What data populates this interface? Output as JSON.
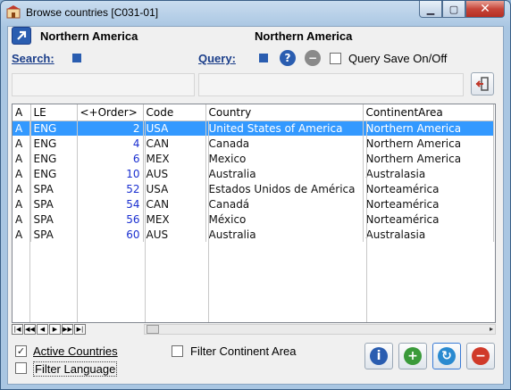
{
  "window": {
    "title": "Browse countries [C031-01]"
  },
  "header": {
    "left_title": "Northern America",
    "center_title": "Northern America",
    "search_label": "Search:",
    "query_label": "Query:",
    "query_save_label": "Query Save On/Off"
  },
  "grid": {
    "columns": [
      "A",
      "LE",
      "<+Order>",
      "Code",
      "Country",
      "ContinentArea"
    ],
    "rows": [
      {
        "a": "A",
        "le": "ENG",
        "order": "2",
        "code": "USA",
        "country": "United States of America",
        "continent": "Northern America",
        "selected": true
      },
      {
        "a": "A",
        "le": "ENG",
        "order": "4",
        "code": "CAN",
        "country": "Canada",
        "continent": "Northern America",
        "selected": false
      },
      {
        "a": "A",
        "le": "ENG",
        "order": "6",
        "code": "MEX",
        "country": "Mexico",
        "continent": "Northern America",
        "selected": false
      },
      {
        "a": "A",
        "le": "ENG",
        "order": "10",
        "code": "AUS",
        "country": "Australia",
        "continent": "Australasia",
        "selected": false
      },
      {
        "a": "A",
        "le": "SPA",
        "order": "52",
        "code": "USA",
        "country": "Estados Unidos de América",
        "continent": "Norteamérica",
        "selected": false
      },
      {
        "a": "A",
        "le": "SPA",
        "order": "54",
        "code": "CAN",
        "country": "Canadá",
        "continent": "Norteamérica",
        "selected": false
      },
      {
        "a": "A",
        "le": "SPA",
        "order": "56",
        "code": "MEX",
        "country": "México",
        "continent": "Norteamérica",
        "selected": false
      },
      {
        "a": "A",
        "le": "SPA",
        "order": "60",
        "code": "AUS",
        "country": "Australia",
        "continent": "Australasia",
        "selected": false
      }
    ]
  },
  "footer": {
    "active_countries_label": "Active Countries",
    "active_countries_checked": true,
    "filter_language_label": "Filter Language",
    "filter_language_checked": false,
    "filter_continent_label": "Filter Continent Area",
    "filter_continent_checked": false
  },
  "colors": {
    "selection": "#3399ff",
    "number_text": "#1a2fd0",
    "accent_blue": "#2a5db0",
    "add_green": "#3a9a3a",
    "delete_red": "#d03a2a"
  }
}
